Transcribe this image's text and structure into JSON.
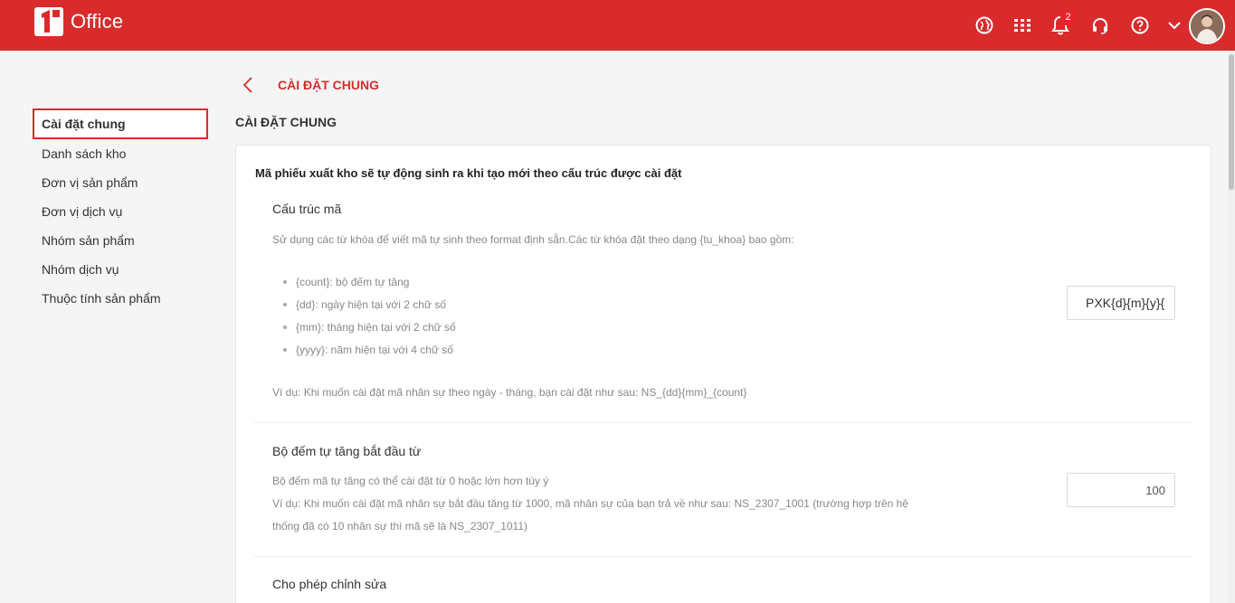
{
  "app": {
    "name": "Office",
    "brand_color": "#d92b2b"
  },
  "header": {
    "icons": [
      "globe-icon",
      "apps-grid-icon",
      "bell-icon",
      "headset-icon",
      "help-icon",
      "chevron-down-icon"
    ],
    "notification_count": "2"
  },
  "sidebar": {
    "items": [
      {
        "label": "Cài đặt chung",
        "active": true
      },
      {
        "label": "Danh sách kho"
      },
      {
        "label": "Đơn vị sản phẩm"
      },
      {
        "label": "Đơn vị dịch vụ"
      },
      {
        "label": "Nhóm sản phẩm"
      },
      {
        "label": "Nhóm dịch vụ"
      },
      {
        "label": "Thuộc tính sản phẩm"
      }
    ]
  },
  "page": {
    "breadcrumb_title": "CÀI ĐẶT CHUNG",
    "section_title": "CÀI ĐẶT CHUNG",
    "card_heading": "Mã phiếu xuất kho sẽ tự động sinh ra khi tạo mới theo cấu trúc được cài đặt"
  },
  "code_structure": {
    "label": "Cấu trúc mã",
    "description": "Sử dụng các từ khóa để viết mã tự sinh theo format định sẵn.Các từ khóa đặt theo dạng {tu_khoa} bao gồm:",
    "keywords": [
      "{count}: bộ đếm tự tăng",
      "{dd}: ngày hiện tại với 2 chữ số",
      "{mm}: tháng hiện tại với 2 chữ số",
      "{yyyy}: năm hiện tại với 4 chữ số"
    ],
    "example": "Ví dụ: Khi muốn cài đặt mã nhân sự theo ngày - tháng, bạn cài đặt như sau: NS_{dd}{mm}_{count}",
    "value": "PXK{d}{m}{y}{i}"
  },
  "counter": {
    "label": "Bộ đếm tự tăng bắt đầu từ",
    "description": "Bộ đếm mã tự tăng có thể cài đặt từ 0 hoặc lớn hơn tùy ý",
    "example_line1": "Ví dụ: Khi muốn cài đặt mã nhân sự bắt đầu tăng từ 1000, mã nhân sự của bạn trả về như sau: NS_2307_1001 (trường hợp trên hệ",
    "example_line2": "thống đã có 10 nhân sự thì mã sẽ là NS_2307_1011)",
    "value": "100"
  },
  "allow_edit": {
    "label": "Cho phép chỉnh sửa"
  }
}
